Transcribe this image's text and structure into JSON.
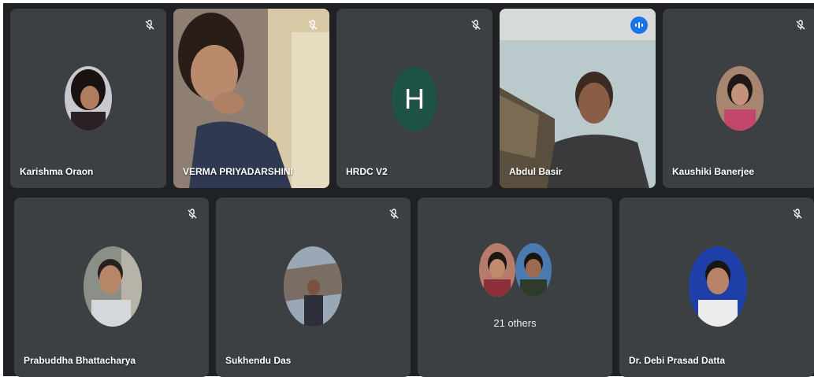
{
  "participants_row1": [
    {
      "name": "Karishma Oraon",
      "muted": true
    },
    {
      "name": "VERMA PRIYADARSHINI",
      "muted": true
    },
    {
      "name": "HRDC V2",
      "muted": true,
      "initial": "H"
    },
    {
      "name": "Abdul Basir",
      "muted": false,
      "speaking": true
    },
    {
      "name": "Kaushiki Banerjee",
      "muted": true
    }
  ],
  "participants_row2": [
    {
      "name": "Prabuddha Bhattacharya",
      "muted": true
    },
    {
      "name": "Sukhendu Das",
      "muted": true
    },
    {
      "name": "Dr. Debi Prasad Datta",
      "muted": true
    }
  ],
  "others": {
    "label": "21 others"
  },
  "icons": {
    "mute": "mic-off-icon",
    "speaking": "audio-level-icon"
  },
  "colors": {
    "tile": "#3c4043",
    "background": "#202124",
    "active_border": "#8ab4f8",
    "avatar_h": "#1e5245",
    "speaking_badge": "#1a73e8"
  }
}
